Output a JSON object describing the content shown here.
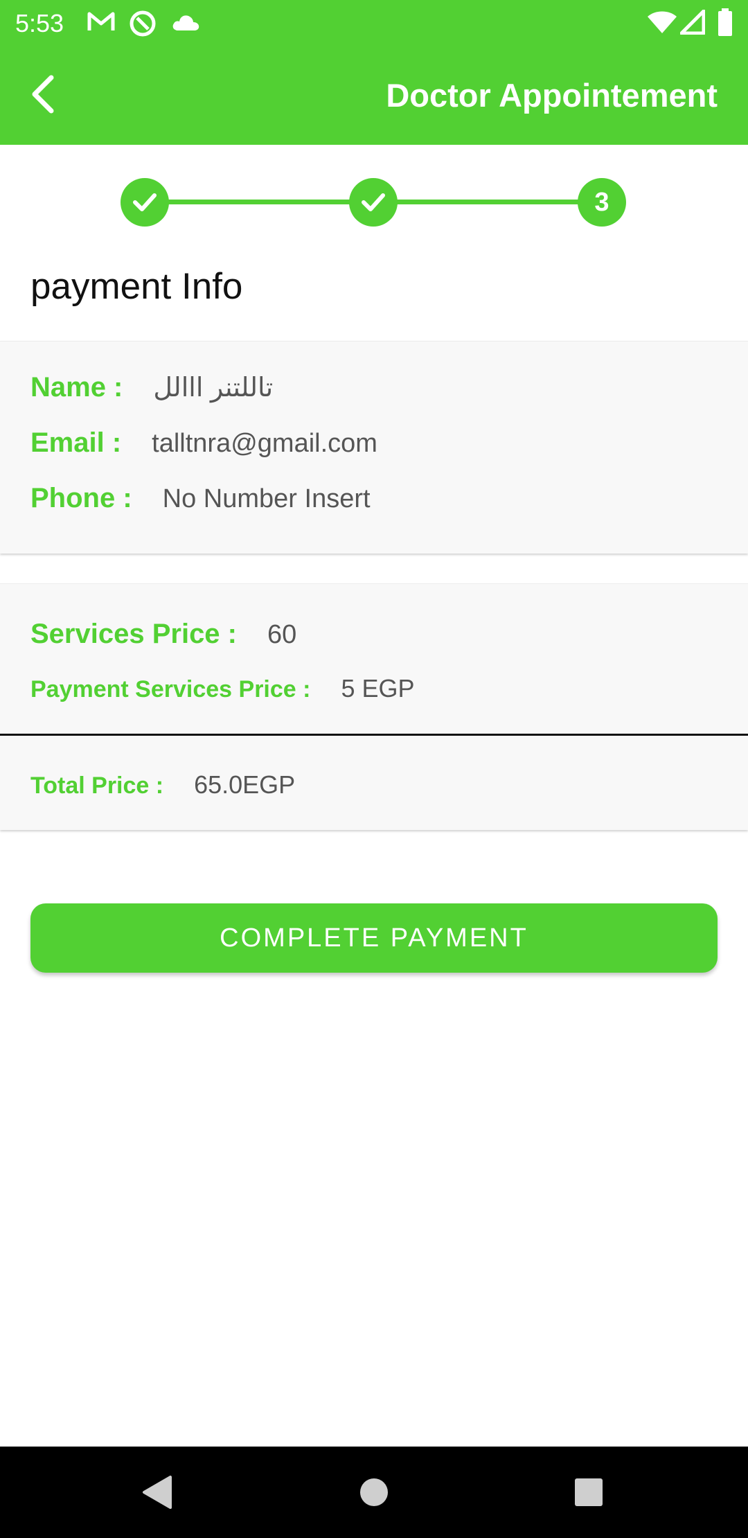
{
  "status_bar": {
    "time": "5:53",
    "icons": [
      "gmail-icon",
      "at-sign-icon",
      "cloud-icon",
      "wifi-icon",
      "signal-icon",
      "battery-icon"
    ]
  },
  "app_bar": {
    "title": "Doctor Appointement",
    "back_icon": "chevron-left-icon"
  },
  "stepper": {
    "steps": [
      {
        "state": "done",
        "icon": "check-icon"
      },
      {
        "state": "done",
        "icon": "check-icon"
      },
      {
        "state": "current",
        "label": "3"
      }
    ]
  },
  "section_title": "payment Info",
  "user_info": {
    "name_label": "Name :",
    "name_value": "تاللتنر ااالل",
    "email_label": "Email :",
    "email_value": "talltnra@gmail.com",
    "phone_label": "Phone :",
    "phone_value": "No Number Insert"
  },
  "pricing": {
    "services_label": "Services Price :",
    "services_value": "60",
    "payment_services_label": "Payment Services Price :",
    "payment_services_value": "5 EGP"
  },
  "total": {
    "label": "Total Price :",
    "value": "65.0EGP"
  },
  "actions": {
    "complete_label": "COMPLETE PAYMENT"
  },
  "nav": {
    "back_icon": "triangle-back-icon",
    "home_icon": "circle-home-icon",
    "recents_icon": "square-recents-icon"
  },
  "colors": {
    "accent": "#52d033",
    "text": "#555555",
    "card_bg": "#f8f8f8"
  }
}
